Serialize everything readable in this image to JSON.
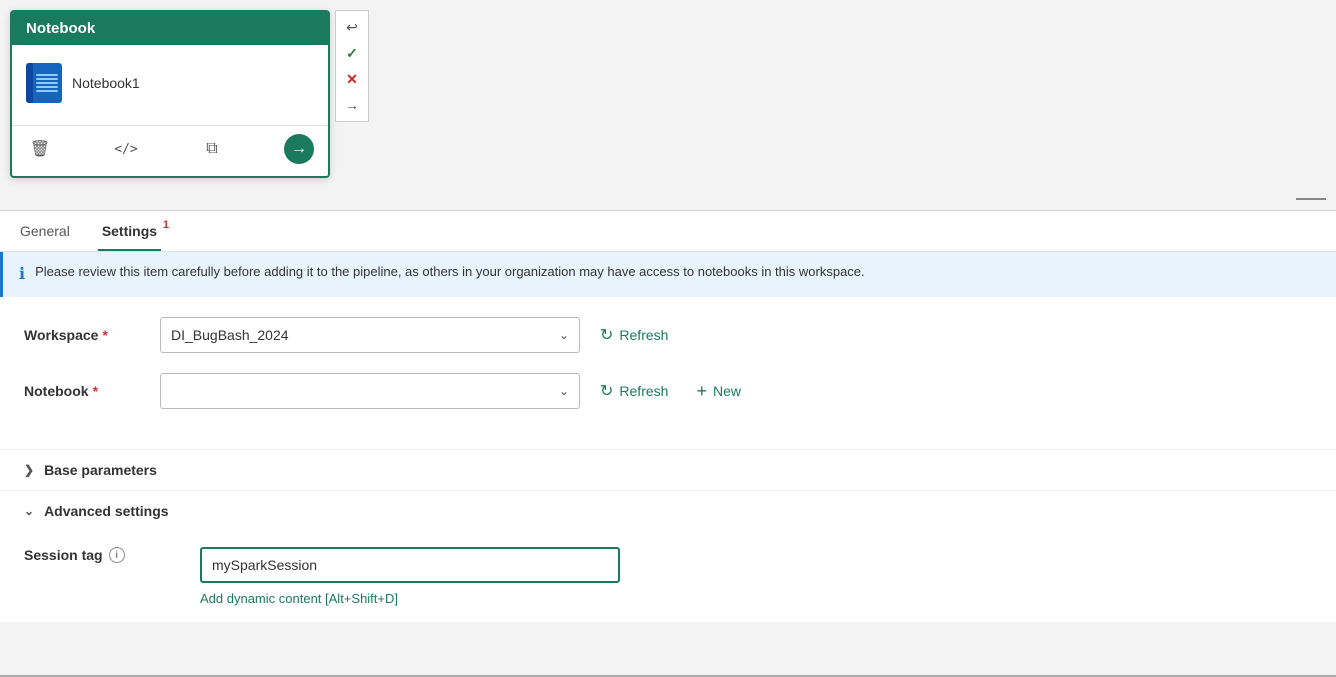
{
  "notebook_card": {
    "title": "Notebook",
    "item_name": "Notebook1",
    "icon_label": "notebook-icon"
  },
  "side_toolbar": {
    "icons": [
      "undo",
      "check",
      "close",
      "arrow-right"
    ]
  },
  "tabs": {
    "general_label": "General",
    "settings_label": "Settings",
    "settings_badge": "1"
  },
  "info_banner": {
    "message": "Please review this item carefully before adding it to the pipeline, as others in your organization may have access to notebooks in this workspace."
  },
  "workspace_field": {
    "label": "Workspace",
    "required": "*",
    "value": "DI_BugBash_2024",
    "refresh_label": "Refresh"
  },
  "notebook_field": {
    "label": "Notebook",
    "required": "*",
    "value": "",
    "refresh_label": "Refresh",
    "new_label": "New"
  },
  "base_parameters": {
    "label": "Base parameters",
    "collapsed": true
  },
  "advanced_settings": {
    "label": "Advanced settings",
    "collapsed": false
  },
  "session_tag": {
    "label": "Session tag",
    "value": "mySparkSession",
    "dynamic_content_label": "Add dynamic content [Alt+Shift+D]"
  },
  "icons": {
    "delete": "🗑",
    "code": "</>",
    "copy": "⧉",
    "arrow_right": "→",
    "refresh_symbol": "↻",
    "plus": "+",
    "chevron_down": "∨",
    "info_i": "i",
    "info_circle": "ℹ"
  }
}
